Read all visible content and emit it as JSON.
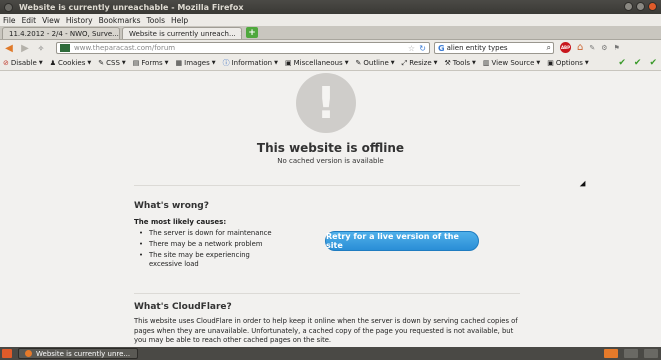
{
  "window": {
    "title": "Website is currently unreachable - Mozilla Firefox"
  },
  "menu": [
    "File",
    "Edit",
    "View",
    "History",
    "Bookmarks",
    "Tools",
    "Help"
  ],
  "tabs": [
    {
      "label": "11.4.2012 - 2/4 - NWO, Surve...",
      "active": false
    },
    {
      "label": "Website is currently unreach...",
      "active": true
    }
  ],
  "nav": {
    "url_host": "www.theparacast.com",
    "url_path": "/forum",
    "search_value": "alien entity types",
    "abp_label": "ABP"
  },
  "devbar": {
    "items": [
      {
        "icon": "⊘",
        "label": "Disable"
      },
      {
        "icon": "♟",
        "label": "Cookies"
      },
      {
        "icon": "✎",
        "label": "CSS"
      },
      {
        "icon": "▤",
        "label": "Forms"
      },
      {
        "icon": "▦",
        "label": "Images"
      },
      {
        "icon": "ⓘ",
        "label": "Information"
      },
      {
        "icon": "▣",
        "label": "Miscellaneous"
      },
      {
        "icon": "✎",
        "label": "Outline"
      },
      {
        "icon": "⤢",
        "label": "Resize"
      },
      {
        "icon": "⚒",
        "label": "Tools"
      },
      {
        "icon": "▥",
        "label": "View Source"
      },
      {
        "icon": "▣",
        "label": "Options"
      }
    ]
  },
  "content": {
    "offline_title": "This website is offline",
    "offline_subtitle": "No cached version is available",
    "wrong_title": "What's wrong?",
    "causes_title": "The most likely causes:",
    "causes": [
      "The server is down for maintenance",
      "There may be a network problem",
      "The site may be experiencing excessive load"
    ],
    "retry_button": "Retry for a live version of the site",
    "cloudflare_title": "What's CloudFlare?",
    "cloudflare_text": "This website uses CloudFlare in order to help keep it online when the server is down by serving cached copies of pages when they are unavailable. Unfortunately, a cached copy of the page you requested is not available, but you may be able to reach other cached pages on the site."
  },
  "taskbar": {
    "task_label": "Website is currently unre..."
  }
}
